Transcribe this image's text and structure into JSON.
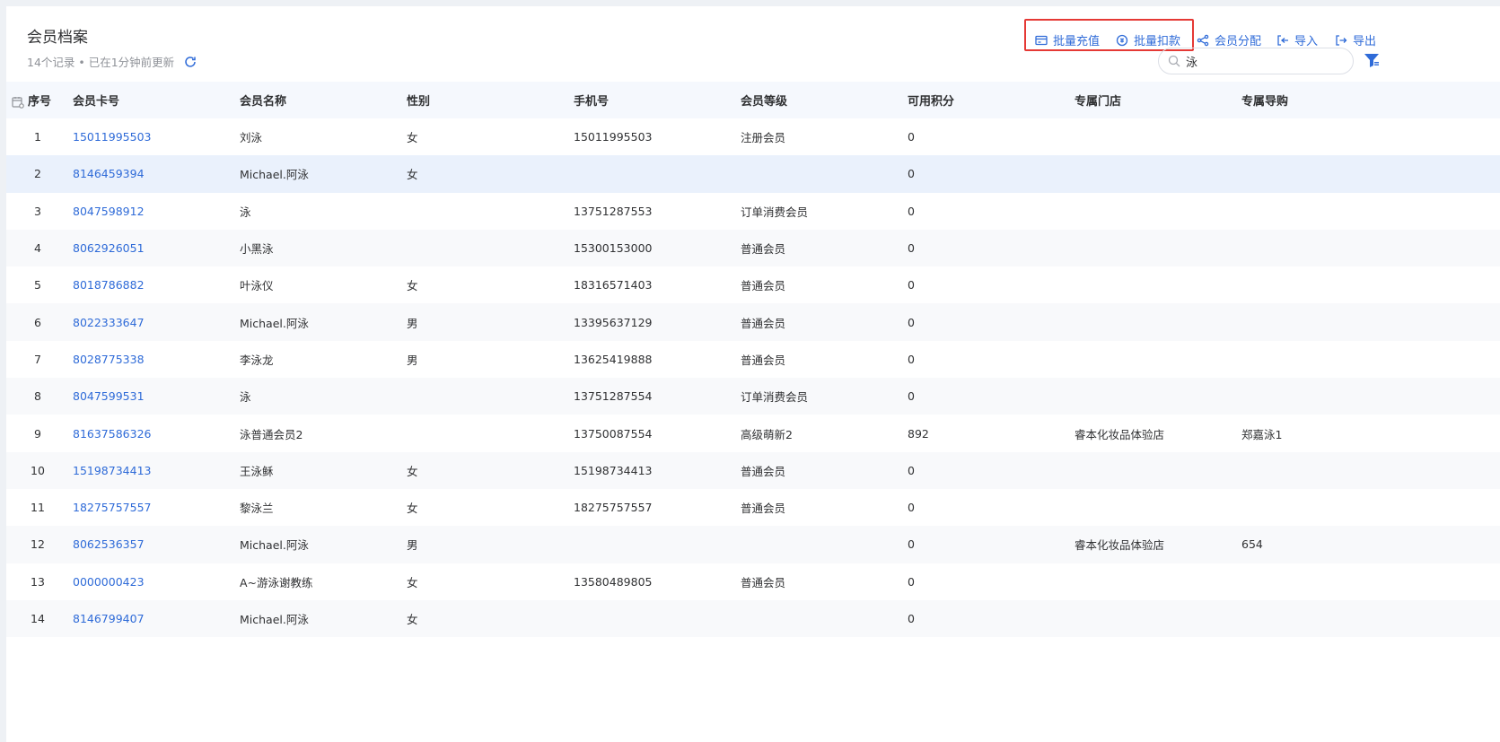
{
  "header": {
    "title": "会员档案",
    "subtitle": "14个记录 • 已在1分钟前更新"
  },
  "toolbar": {
    "batch_recharge": "批量充值",
    "batch_deduct": "批量扣款",
    "member_assign": "会员分配",
    "import": "导入",
    "export": "导出"
  },
  "search": {
    "value": "泳",
    "placeholder": ""
  },
  "table": {
    "columns": [
      "序号",
      "会员卡号",
      "会员名称",
      "性别",
      "手机号",
      "会员等级",
      "可用积分",
      "专属门店",
      "专属导购"
    ],
    "rows": [
      [
        "1",
        "15011995503",
        "刘泳",
        "女",
        "15011995503",
        "注册会员",
        "0",
        "",
        ""
      ],
      [
        "2",
        "8146459394",
        "Michael.阿泳",
        "女",
        "",
        "",
        "0",
        "",
        ""
      ],
      [
        "3",
        "8047598912",
        "泳",
        "",
        "13751287553",
        "订单消费会员",
        "0",
        "",
        ""
      ],
      [
        "4",
        "8062926051",
        "小黑泳",
        "",
        "15300153000",
        "普通会员",
        "0",
        "",
        ""
      ],
      [
        "5",
        "8018786882",
        "叶泳仪",
        "女",
        "18316571403",
        "普通会员",
        "0",
        "",
        ""
      ],
      [
        "6",
        "8022333647",
        "Michael.阿泳",
        "男",
        "13395637129",
        "普通会员",
        "0",
        "",
        ""
      ],
      [
        "7",
        "8028775338",
        "李泳龙",
        "男",
        "13625419888",
        "普通会员",
        "0",
        "",
        ""
      ],
      [
        "8",
        "8047599531",
        "泳",
        "",
        "13751287554",
        "订单消费会员",
        "0",
        "",
        ""
      ],
      [
        "9",
        "81637586326",
        "泳普通会员2",
        "",
        "13750087554",
        "高级萌新2",
        "892",
        "睿本化妆品体验店",
        "郑嘉泳1"
      ],
      [
        "10",
        "15198734413",
        "王泳稣",
        "女",
        "15198734413",
        "普通会员",
        "0",
        "",
        ""
      ],
      [
        "11",
        "18275757557",
        "黎泳兰",
        "女",
        "18275757557",
        "普通会员",
        "0",
        "",
        ""
      ],
      [
        "12",
        "8062536357",
        "Michael.阿泳",
        "男",
        "",
        "",
        "0",
        "睿本化妆品体验店",
        "654"
      ],
      [
        "13",
        "0000000423",
        "A~游泳谢教练",
        "女",
        "13580489805",
        "普通会员",
        "0",
        "",
        ""
      ],
      [
        "14",
        "8146799407",
        "Michael.阿泳",
        "女",
        "",
        "",
        "0",
        "",
        ""
      ]
    ],
    "active_row": 2
  },
  "colors": {
    "accent": "#2f6bd8",
    "highlight_border": "#e53935"
  }
}
